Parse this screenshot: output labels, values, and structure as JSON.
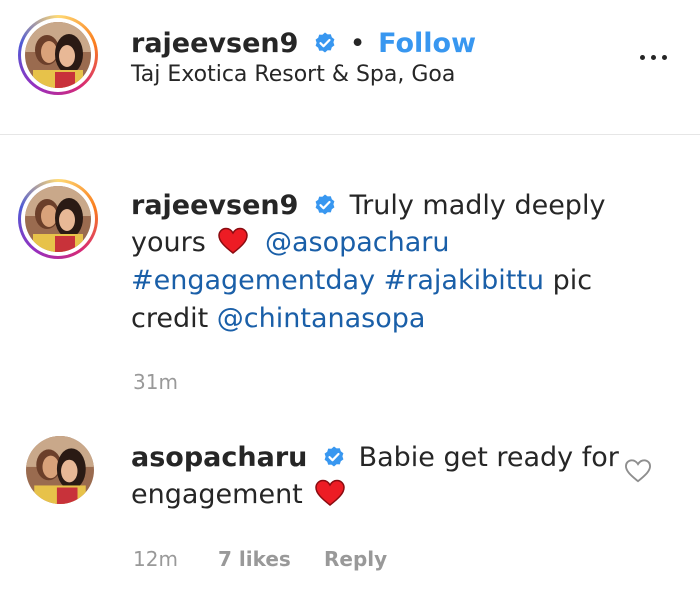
{
  "header": {
    "username": "rajeevsen9",
    "separator": "•",
    "follow_label": "Follow",
    "location": "Taj Exotica Resort & Spa, Goa",
    "more_icon": "more-options-icon"
  },
  "caption": {
    "username": "rajeevsen9",
    "text_part1": "Truly madly deeply",
    "text_part2": "yours",
    "mention1": "@asopacharu",
    "hashtag1": "#engagementday",
    "hashtag2": "#rajakibittu",
    "text_part3": "pic",
    "text_part4": "credit",
    "mention2": "@chintanasopa",
    "time": "31m"
  },
  "comment": {
    "username": "asopacharu",
    "text_part1": "Babie get ready for",
    "text_part2": "engagement",
    "time": "12m",
    "likes": "7 likes",
    "reply_label": "Reply"
  },
  "colors": {
    "link": "#1a5fa8",
    "follow": "#3897f0",
    "verified": "#3897f0",
    "heart": "#ed1c24"
  }
}
